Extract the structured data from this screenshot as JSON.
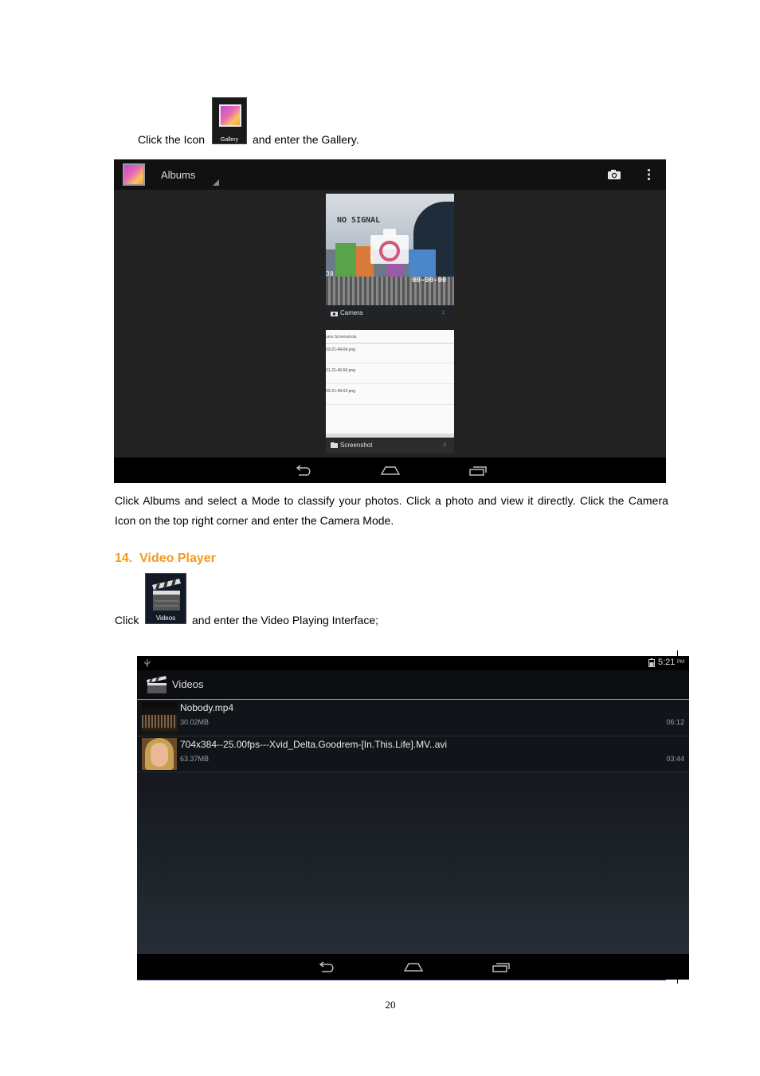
{
  "gallery_intro": {
    "before": "Click the Icon",
    "icon_label": "Gallery",
    "after": "and enter the Gallery."
  },
  "gallery_screen": {
    "title": "Albums",
    "albums": [
      {
        "name": "Camera",
        "count": "1"
      },
      {
        "name": "Screenshot",
        "count": "5"
      }
    ],
    "camera_thumb_text": {
      "sign": "NO  SIGNAL",
      "code": "00-00-00",
      "side": "30"
    },
    "screenshot_thumb": {
      "breadcrumb": "ums  Screenshots",
      "files": [
        "03-21-49-04.png",
        "01-21-49-56.png",
        "03-21-49-02.png"
      ]
    }
  },
  "gallery_desc": {
    "line1": "Click Albums and select a Mode to classify your photos. Click a photo and view it directly. Click the Camera",
    "line2": "Icon on the top right corner and enter the Camera Mode."
  },
  "section": {
    "heading": "14.  Video Player"
  },
  "video_intro": {
    "before": "Click",
    "icon_label": "Videos",
    "after": "and enter the Video Playing Interface;"
  },
  "video_screen": {
    "status_time": "5:21",
    "status_ampm": "PM",
    "title": "Videos",
    "videos": [
      {
        "name": "Nobody.mp4",
        "size": "30.02MB",
        "duration": "06:12"
      },
      {
        "name": "704x384--25.00fps---Xvid_Delta.Goodrem-[In.This.Life].MV..avi",
        "size": "63.37MB",
        "duration": "03:44"
      }
    ]
  },
  "page_number": "20"
}
